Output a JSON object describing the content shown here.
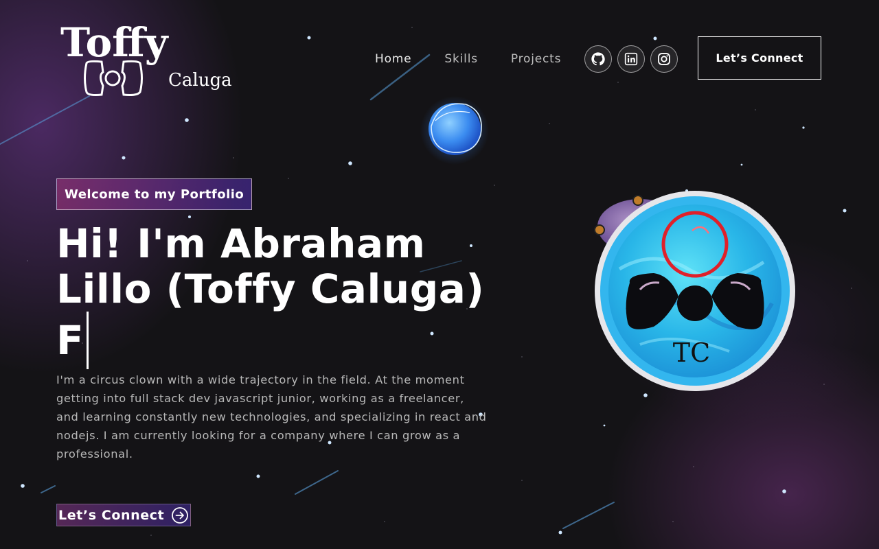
{
  "logo": {
    "primary": "Toffy",
    "secondary": "Caluga"
  },
  "nav": {
    "items": [
      "Home",
      "Skills",
      "Projects"
    ],
    "social_icons": [
      "github-icon",
      "linkedin-icon",
      "instagram-icon"
    ],
    "cta_label": "Let’s Connect"
  },
  "hero": {
    "tagline": "Welcome to my Portfolio",
    "headline_line1": "Hi! I'm Abraham",
    "headline_line2": "Lillo (Toffy Caluga)",
    "headline_typing": "F",
    "bio": "I'm a circus clown with a wide trajectory in the field. At the moment getting into full stack dev javascript junior, working as a freelancer, and learning constantly new technologies, and specializing in react and nodejs. I am currently looking for a company where I can grow as a professional.",
    "cta_label": "Let’s Connect",
    "cta_icon": "arrow-right-circle-icon"
  },
  "avatar": {
    "initials": "TC"
  },
  "colors": {
    "background": "#141316",
    "accent_pink": "#aa367c",
    "accent_violet": "#4a2fbd",
    "planet_blue": "#3db8f0",
    "ring_red": "#e0202a"
  }
}
